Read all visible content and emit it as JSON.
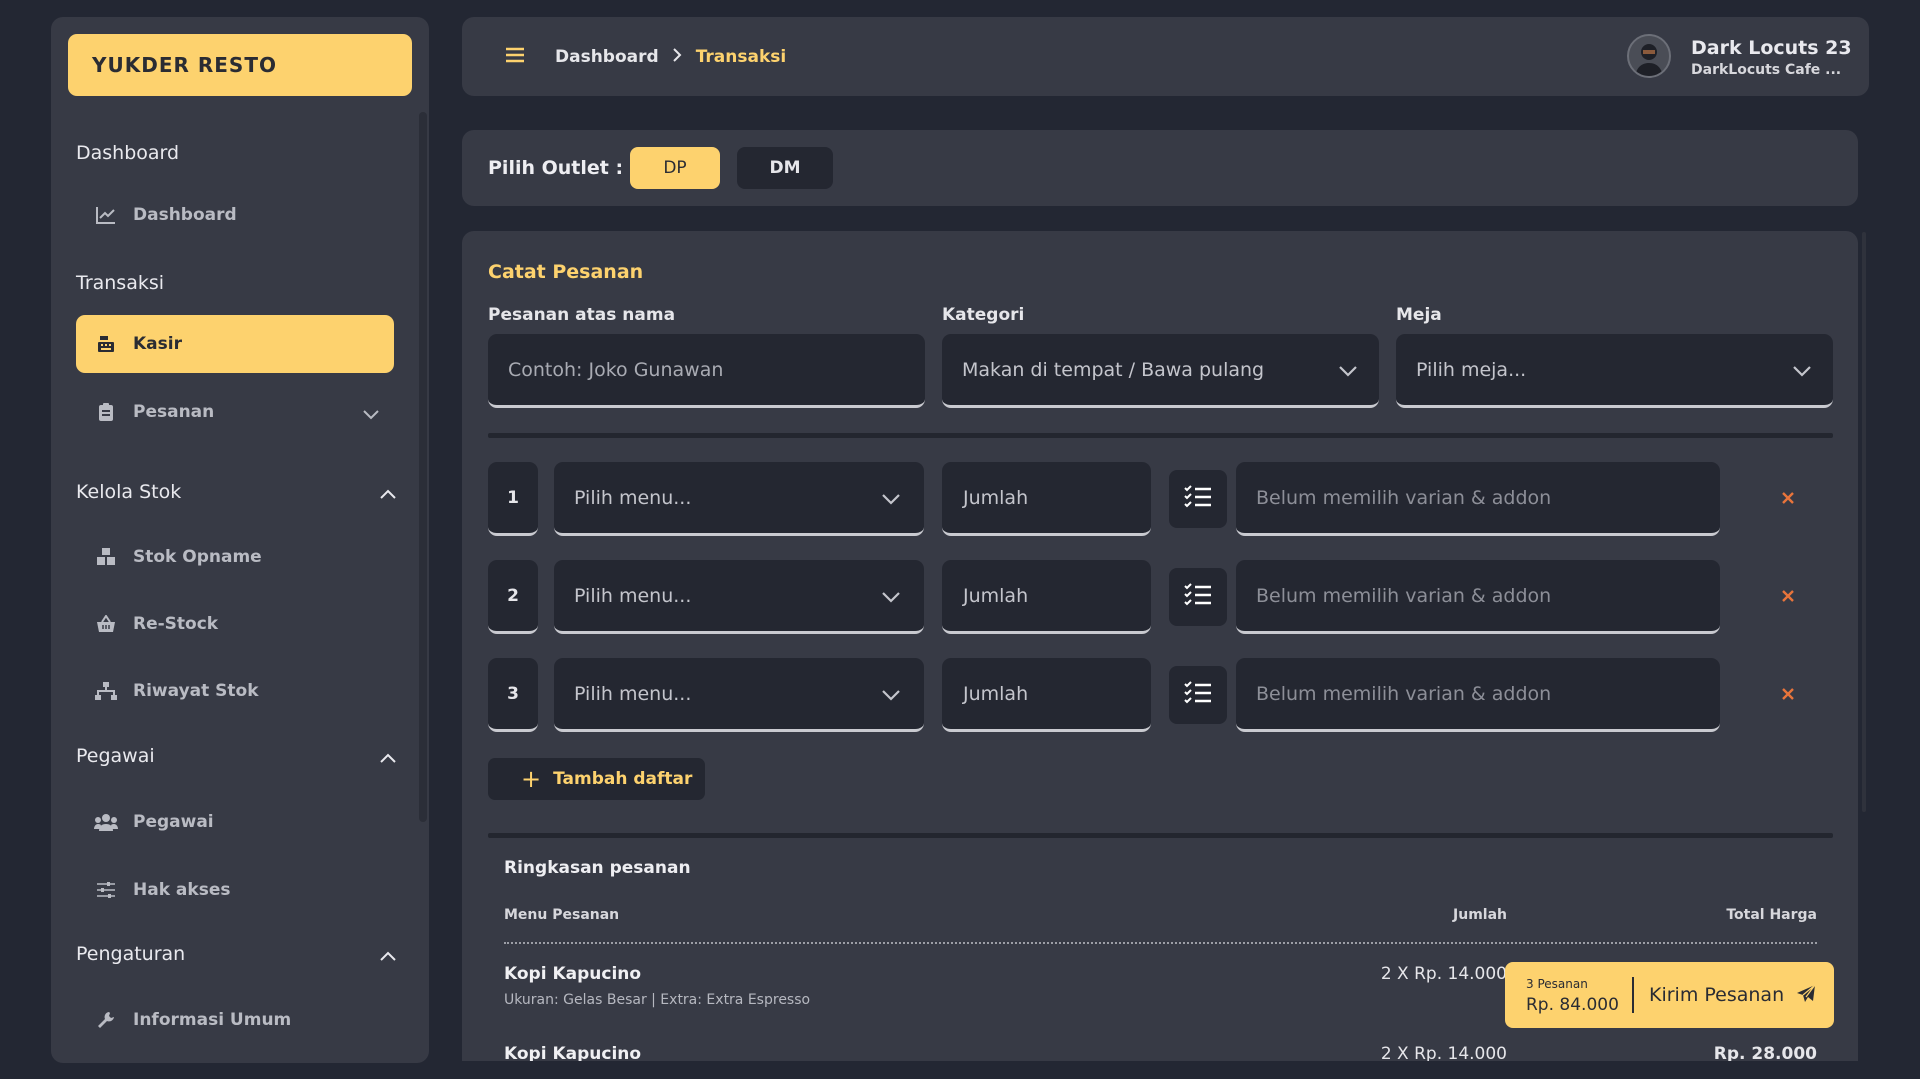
{
  "sidebar": {
    "brand": "YUKDER RESTO",
    "sections": [
      {
        "title": "Dashboard",
        "items": [
          {
            "label": "Dashboard",
            "icon": "chart-line-icon"
          }
        ]
      },
      {
        "title": "Transaksi",
        "items": [
          {
            "label": "Kasir",
            "icon": "cash-register-icon",
            "active": true
          },
          {
            "label": "Pesanan",
            "icon": "clipboard-icon"
          }
        ]
      },
      {
        "title": "Kelola Stok",
        "items": [
          {
            "label": "Stok Opname",
            "icon": "boxes-icon"
          },
          {
            "label": "Re-Stock",
            "icon": "basket-icon"
          },
          {
            "label": "Riwayat Stok",
            "icon": "sitemap-icon"
          }
        ]
      },
      {
        "title": "Pegawai",
        "items": [
          {
            "label": "Pegawai",
            "icon": "users-icon"
          },
          {
            "label": "Hak akses",
            "icon": "sliders-icon"
          }
        ]
      },
      {
        "title": "Pengaturan",
        "items": [
          {
            "label": "Informasi Umum",
            "icon": "wrench-icon"
          }
        ]
      }
    ]
  },
  "header": {
    "breadcrumb": [
      "Dashboard",
      "Transaksi"
    ],
    "user_name": "Dark Locuts 23",
    "user_cafe": "DarkLocuts Cafe ..."
  },
  "outlet": {
    "label": "Pilih Outlet :",
    "options": [
      "DP",
      "DM"
    ],
    "selected": "DP"
  },
  "order": {
    "title": "Catat Pesanan",
    "name_label": "Pesanan atas nama",
    "name_placeholder": "Contoh: Joko Gunawan",
    "category_label": "Kategori",
    "category_value": "Makan di tempat / Bawa pulang",
    "table_label": "Meja",
    "table_value": "Pilih meja...",
    "rows": [
      {
        "no": "1",
        "menu": "Pilih menu...",
        "qty": "Jumlah",
        "variant": "Belum memilih varian & addon"
      },
      {
        "no": "2",
        "menu": "Pilih menu...",
        "qty": "Jumlah",
        "variant": "Belum memilih varian & addon"
      },
      {
        "no": "3",
        "menu": "Pilih menu...",
        "qty": "Jumlah",
        "variant": "Belum memilih varian & addon"
      }
    ],
    "add_label": "Tambah daftar"
  },
  "summary": {
    "title": "Ringkasan pesanan",
    "columns": [
      "Menu Pesanan",
      "Jumlah",
      "Total Harga"
    ],
    "items": [
      {
        "name": "Kopi Kapucino",
        "desc": "Ukuran: Gelas Besar | Extra: Extra Espresso",
        "qty": "2 X Rp. 14.000",
        "total": ""
      },
      {
        "name": "Kopi Kapucino",
        "desc": "",
        "qty": "2 X Rp. 14.000",
        "total": "Rp. 28.000"
      }
    ]
  },
  "send": {
    "count": "3 Pesanan",
    "price": "Rp. 84.000",
    "label": "Kirim Pesanan"
  },
  "colors": {
    "accent": "#fdd26e",
    "bg": "#232733",
    "panel": "#373a45",
    "input": "#242731",
    "danger": "#e8743b"
  }
}
